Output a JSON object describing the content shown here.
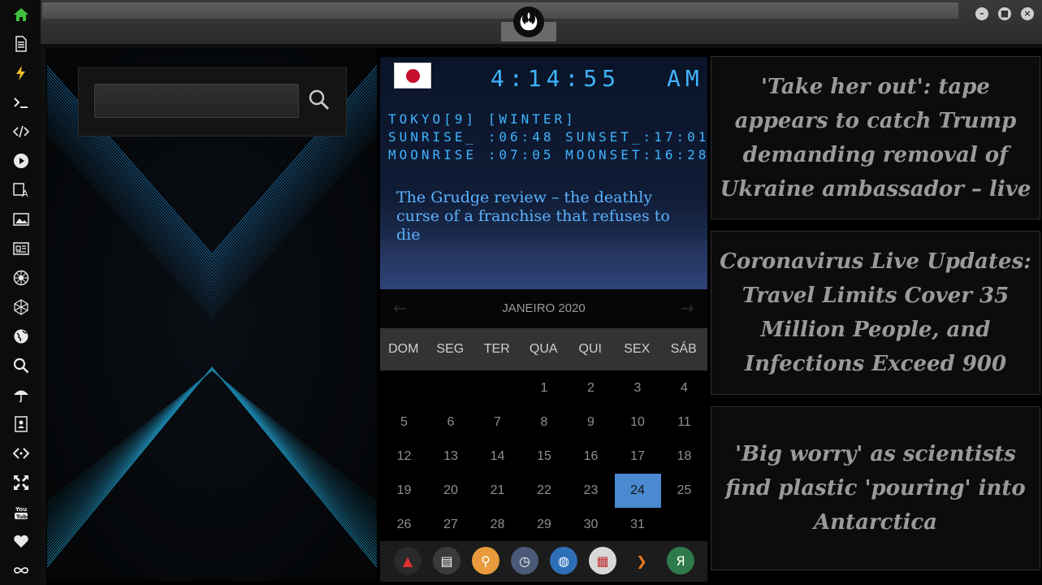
{
  "search": {
    "value": "",
    "placeholder": ""
  },
  "clock": {
    "time": "4:14:55",
    "ampm": "AM",
    "city_line": "TOKYO[9] [WINTER]",
    "sun_line": "SUNRISE_ :06:48 SUNSET_:17:01",
    "moon_line": "MOONRISE :07:05 MOONSET:16:28",
    "headline": "The Grudge review – the deathly curse of a franchise that refuses to die"
  },
  "calendar": {
    "title": "JANEIRO 2020",
    "prev_arrow": "←",
    "next_arrow": "→",
    "day_names": [
      "DOM",
      "SEG",
      "TER",
      "QUA",
      "QUI",
      "SEX",
      "SÁB"
    ],
    "weeks": [
      [
        "",
        "",
        "",
        "1",
        "2",
        "3",
        "4"
      ],
      [
        "5",
        "6",
        "7",
        "8",
        "9",
        "10",
        "11"
      ],
      [
        "12",
        "13",
        "14",
        "15",
        "16",
        "17",
        "18"
      ],
      [
        "19",
        "20",
        "21",
        "22",
        "23",
        "24",
        "25"
      ],
      [
        "26",
        "27",
        "28",
        "29",
        "30",
        "31",
        ""
      ]
    ],
    "today": "24"
  },
  "news": [
    "'Take her out': tape appears to catch Trump demanding removal of Ukraine ambassador – live",
    "Coronavirus Live Updates: Travel Limits Cover 35 Million People, and Infections Exceed 900",
    "'Big worry' as scientists find plastic 'pouring' into Antarctica"
  ],
  "sidebar_icons": [
    "home-icon",
    "document-icon",
    "lightning-icon",
    "terminal-icon",
    "code-icon",
    "play-icon",
    "translate-icon",
    "image-icon",
    "news-icon",
    "empire-icon",
    "hexagon-icon",
    "globe-icon",
    "search-icon",
    "umbrella-icon",
    "contacts-icon",
    "code-brackets-icon",
    "expand-icon",
    "youtube-icon",
    "heart-icon",
    "infinity-icon"
  ],
  "dock_icons": [
    {
      "name": "app-red-icon",
      "color": "#2a2a2a",
      "glyph": "▲"
    },
    {
      "name": "newspaper-icon",
      "color": "#3a3a3a",
      "glyph": "▤"
    },
    {
      "name": "search-app-icon",
      "color": "#e89a3c",
      "glyph": "⚲"
    },
    {
      "name": "clock-app-icon",
      "color": "#4a5a78",
      "glyph": "◷"
    },
    {
      "name": "globe-app-icon",
      "color": "#2f6fb8",
      "glyph": "◍"
    },
    {
      "name": "calendar-app-icon",
      "color": "#d8d8d8",
      "glyph": "▦"
    },
    {
      "name": "arrow-app-icon",
      "color": "#1c1c1c",
      "glyph": "❯"
    },
    {
      "name": "yandex-app-icon",
      "color": "#2e7a4a",
      "glyph": "Я"
    }
  ],
  "colors": {
    "accent": "#3fb4ff",
    "today": "#4a8ad0",
    "sidebar_active": "#3fbf3f"
  }
}
